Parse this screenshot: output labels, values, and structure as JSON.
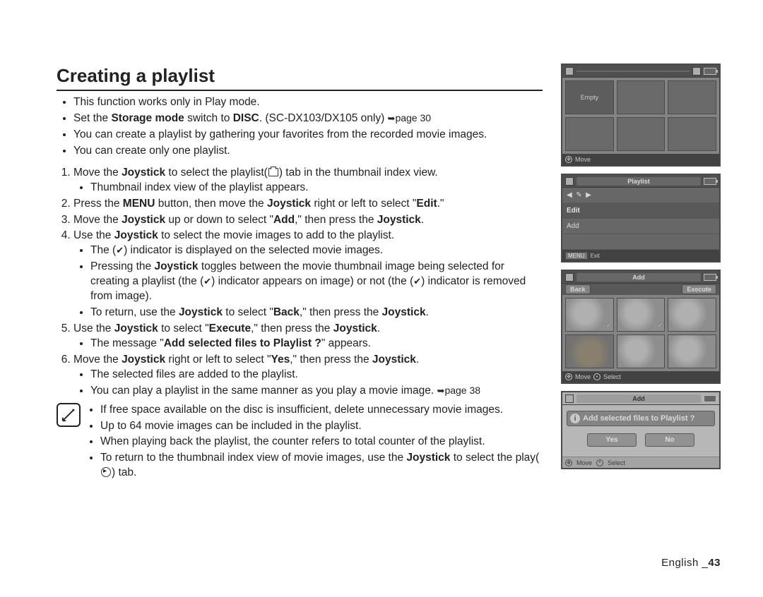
{
  "title": "Creating a playlist",
  "intro": [
    "This function works only in Play mode.",
    {
      "pre": "Set the ",
      "b1": "Storage mode",
      "mid": " switch to ",
      "b2": "DISC",
      "post": ". (SC-DX103/DX105 only) ",
      "arrow": "➥",
      "ref": "page 30"
    },
    "You can create a playlist by gathering your favorites from the recorded movie images.",
    "You can create only one playlist."
  ],
  "steps": {
    "s1": {
      "t1": "Move the ",
      "b1": "Joystick",
      "t2": " to select the playlist(",
      "t3": ") tab in the thumbnail index view.",
      "sub": [
        "Thumbnail index view of the playlist appears."
      ]
    },
    "s2": {
      "t1": "Press the ",
      "b1": "MENU",
      "t2": " button, then move the ",
      "b2": "Joystick",
      "t3": " right or left to select \"",
      "b3": "Edit",
      "t4": ".\""
    },
    "s3": {
      "t1": "Move the ",
      "b1": "Joystick",
      "t2": " up or down to select \"",
      "b2": "Add",
      "t3": ",\" then press the ",
      "b3": "Joystick",
      "t4": "."
    },
    "s4": {
      "t1": "Use the ",
      "b1": "Joystick",
      "t2": " to select the movie images to add to the playlist.",
      "sub1": {
        "a": "The (",
        "chk": "✔",
        "b": ") indicator is displayed on the selected movie images."
      },
      "sub2": {
        "a": "Pressing the ",
        "b1": "Joystick",
        "b": " toggles between the movie thumbnail image being selected for creating a playlist (the (",
        "chk": "✔",
        "c": ") indicator appears on image) or not (the (",
        "chk2": "✔",
        "d": ") indicator is removed from image)."
      },
      "sub3": {
        "a": "To return, use the ",
        "b1": "Joystick",
        "b": " to select \"",
        "b2": "Back",
        "c": ",\" then press the ",
        "b3": "Joystick",
        "d": "."
      }
    },
    "s5": {
      "t1": "Use the ",
      "b1": "Joystick",
      "t2": " to select \"",
      "b2": "Execute",
      "t3": ",\" then press the ",
      "b3": "Joystick",
      "t4": ".",
      "sub": {
        "a": "The message \"",
        "b1": "Add selected files to Playlist ?",
        "b": "\" appears."
      }
    },
    "s6": {
      "t1": "Move the ",
      "b1": "Joystick",
      "t2": " right or left to select \"",
      "b2": "Yes",
      "t3": ",\" then press the ",
      "b3": "Joystick",
      "t4": ".",
      "sub1": "The selected files are added to the playlist.",
      "sub2": {
        "a": "You can play a playlist in the same manner as you play a movie image. ",
        "arrow": "➥",
        "ref": "page 38"
      }
    }
  },
  "notes": [
    "If free space available on the disc is insufficient, delete unnecessary movie images.",
    "Up to 64 movie images can be included in the playlist.",
    "When playing back the playlist, the counter refers to total counter of the playlist.",
    {
      "a": "To return to the thumbnail index view of movie images, use the ",
      "b1": "Joystick",
      "b": " to select the play(",
      "c": ") tab."
    }
  ],
  "figs": {
    "f1": {
      "empty": "Empty",
      "move": "Move"
    },
    "f2": {
      "title": "Playlist",
      "hdr": "Edit",
      "item": "Add",
      "menu": "MENU",
      "exit": "Exit"
    },
    "f3": {
      "title": "Add",
      "back": "Back",
      "exec": "Execute",
      "move": "Move",
      "select": "Select"
    },
    "f4": {
      "title": "Add",
      "prompt": "Add selected files to Playlist ?",
      "yes": "Yes",
      "no": "No",
      "move": "Move",
      "select": "Select"
    }
  },
  "footer": {
    "lang": "English _",
    "page": "43"
  }
}
